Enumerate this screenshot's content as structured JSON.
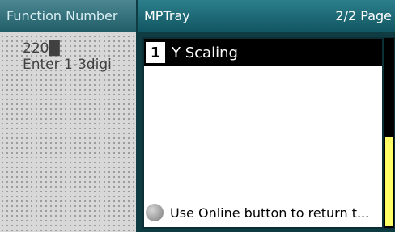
{
  "left_panel": {
    "title": "Function Number",
    "line1": "220█",
    "line2": "Enter 1-3digi"
  },
  "window": {
    "title": "MPTray",
    "page_info": "2/2 Page"
  },
  "list": {
    "items": [
      {
        "number": "1",
        "label": "Y Scaling"
      }
    ]
  },
  "footer": {
    "text": "Use Online button to return t..."
  },
  "colors": {
    "title_bar": "#1f6b78",
    "selected_item_bg": "#000000",
    "scroll_thumb": "#ffff66"
  },
  "scrollbar": {
    "position_fraction": 0.5
  }
}
